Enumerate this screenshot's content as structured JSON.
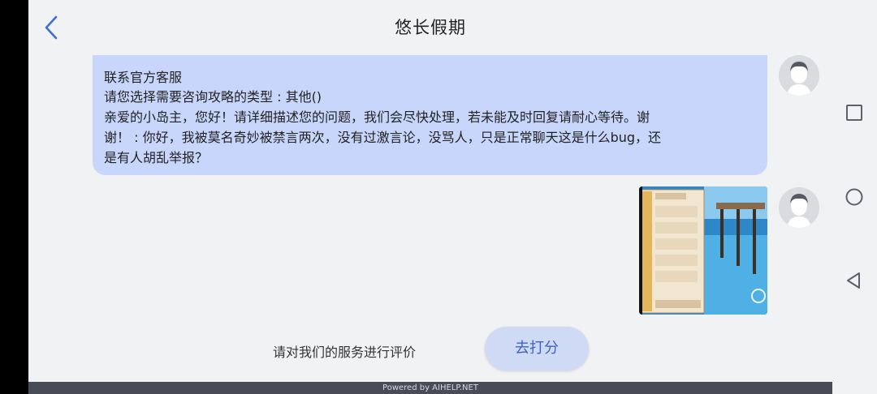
{
  "header": {
    "title": "悠长假期",
    "back_icon": "chevron-left-icon"
  },
  "messages": [
    {
      "type": "text",
      "lines": [
        "联系官方客服",
        "请您选择需要咨询攻略的类型 : 其他()",
        "亲爱的小岛主，您好！请详细描述您的问题，我们会尽快处理，若未能及时回复请耐心等待。谢",
        "谢！ : 你好，我被莫名奇妙被禁言两次，没有过激言论，没骂人，只是正常聊天这是什么bug，还",
        "是有人胡乱举报？"
      ]
    },
    {
      "type": "image",
      "description_icon": "game-screenshot-thumbnail"
    }
  ],
  "footer": {
    "rating_prompt": "请对我们的服务进行评价",
    "rate_button": "去打分",
    "powered_by": "Powered by AIHELP.NET"
  },
  "system_nav": {
    "recents_icon": "square-icon",
    "home_icon": "circle-icon",
    "back_icon": "triangle-back-icon"
  },
  "colors": {
    "bubble": "#c8d6fb",
    "accent": "#3e63c7",
    "background": "#f1f2f4"
  }
}
